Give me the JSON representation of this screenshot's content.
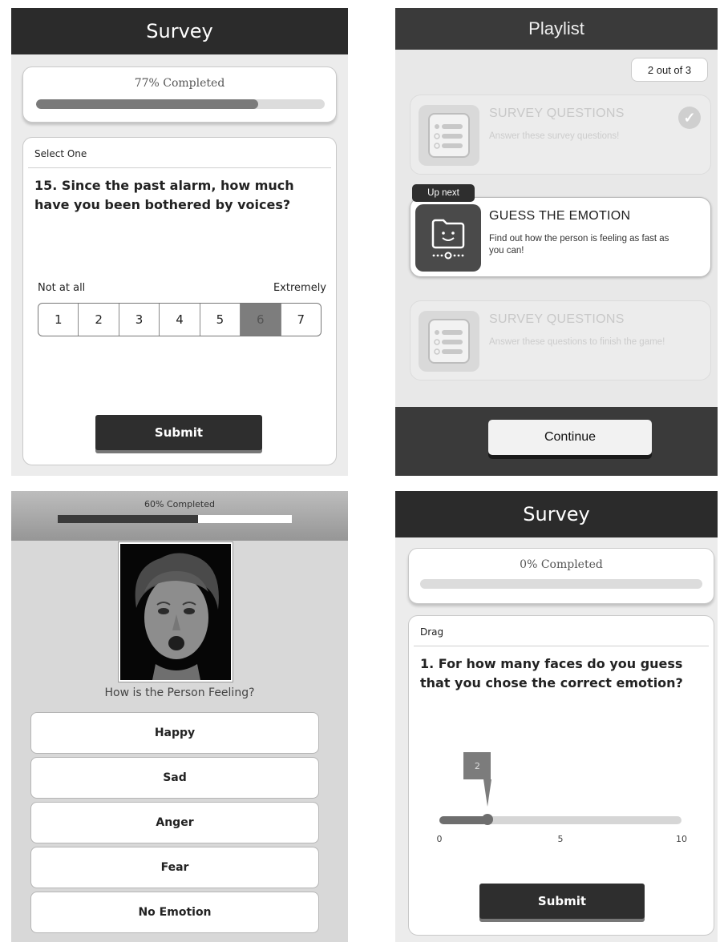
{
  "survey_top": {
    "title": "Survey",
    "progress_text": "77% Completed",
    "progress": 0.77,
    "question_type": "Select One",
    "question": "15. Since the past alarm, how much have you been bothered by voices?",
    "scale_min_label": "Not at all",
    "scale_max_label": "Extremely",
    "scale_options": [
      "1",
      "2",
      "3",
      "4",
      "5",
      "6",
      "7"
    ],
    "selected_option": "6",
    "submit_label": "Submit"
  },
  "playlist": {
    "title": "Playlist",
    "counter": "2 out of 3",
    "up_next_label": "Up next",
    "items": [
      {
        "title": "SURVEY QUESTIONS",
        "description": "Answer these survey questions!",
        "state": "completed",
        "icon": "checklist-icon"
      },
      {
        "title": "GUESS THE EMOTION",
        "description": "Find out how the person is feeling as fast as you can!",
        "state": "up-next",
        "icon": "smiley-folder-icon"
      },
      {
        "title": "SURVEY QUESTIONS",
        "description": "Answer these questions to finish the game!",
        "state": "locked",
        "icon": "checklist-icon"
      }
    ],
    "continue_label": "Continue"
  },
  "emotion": {
    "progress_text": "60% Completed",
    "progress": 0.6,
    "question": "How is the Person Feeling?",
    "options": [
      "Happy",
      "Sad",
      "Anger",
      "Fear",
      "No Emotion"
    ]
  },
  "survey_bottom": {
    "title": "Survey",
    "progress_text": "0% Completed",
    "progress": 0,
    "question_type": "Drag",
    "question": "1. For how many faces do you guess that you chose the correct emotion?",
    "slider_value": 2,
    "slider_display": "2",
    "slider_min": 0,
    "slider_max": 10,
    "tick_labels": [
      "0",
      "5",
      "10"
    ],
    "submit_label": "Submit"
  }
}
